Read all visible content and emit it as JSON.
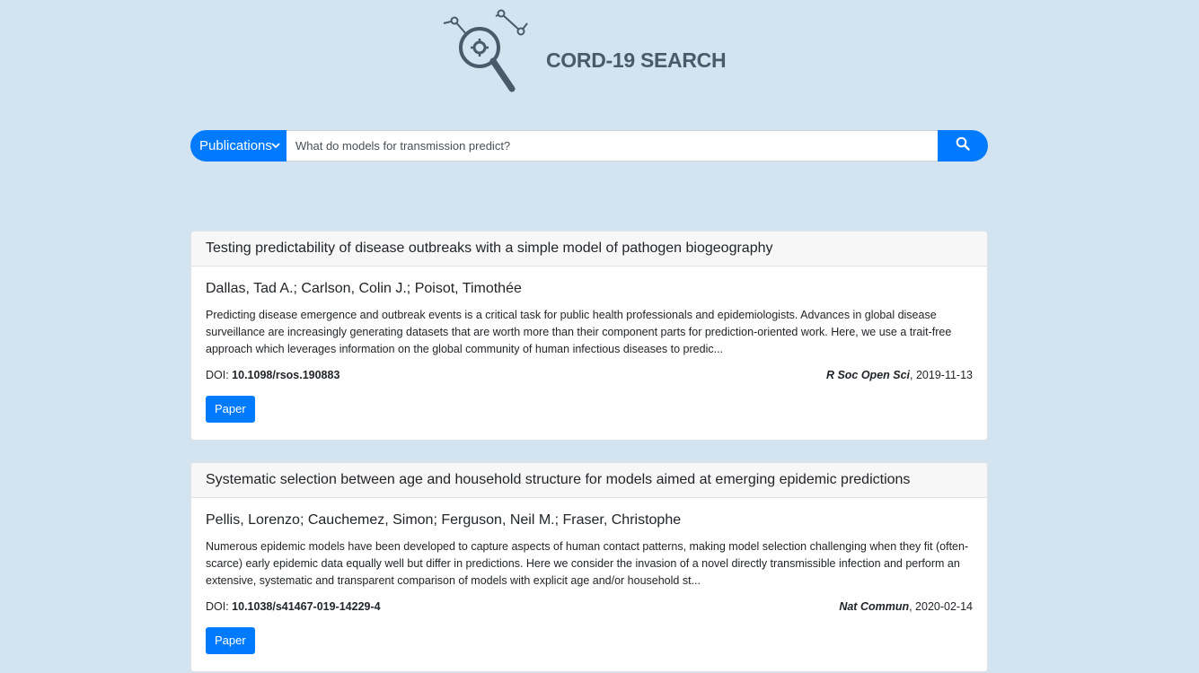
{
  "app": {
    "title": "CORD-19 SEARCH",
    "accent_color": "#007bff",
    "background_color": "#d3e3f0"
  },
  "search": {
    "category": "Publications",
    "query": "What do models for transmission predict?",
    "button_icon": "search-icon"
  },
  "results": [
    {
      "title": "Testing predictability of disease outbreaks with a simple model of pathogen biogeography",
      "authors": "Dallas, Tad A.; Carlson, Colin J.; Poisot, Timothée",
      "abstract": "Predicting disease emergence and outbreak events is a critical task for public health professionals and epidemiologists. Advances in global disease surveillance are increasingly generating datasets that are worth more than their component parts for prediction-oriented work. Here, we use a trait-free approach which leverages information on the global community of human infectious diseases to predic...",
      "doi_label": "DOI: ",
      "doi": "10.1098/rsos.190883",
      "journal": "R Soc Open Sci",
      "date": ", 2019-11-13",
      "button": "Paper"
    },
    {
      "title": "Systematic selection between age and household structure for models aimed at emerging epidemic predictions",
      "authors": "Pellis, Lorenzo; Cauchemez, Simon; Ferguson, Neil M.; Fraser, Christophe",
      "abstract": "Numerous epidemic models have been developed to capture aspects of human contact patterns, making model selection challenging when they fit (often-scarce) early epidemic data equally well but differ in predictions. Here we consider the invasion of a novel directly transmissible infection and perform an extensive, systematic and transparent comparison of models with explicit age and/or household st...",
      "doi_label": "DOI: ",
      "doi": "10.1038/s41467-019-14229-4",
      "journal": "Nat Commun",
      "date": ", 2020-02-14",
      "button": "Paper"
    }
  ]
}
